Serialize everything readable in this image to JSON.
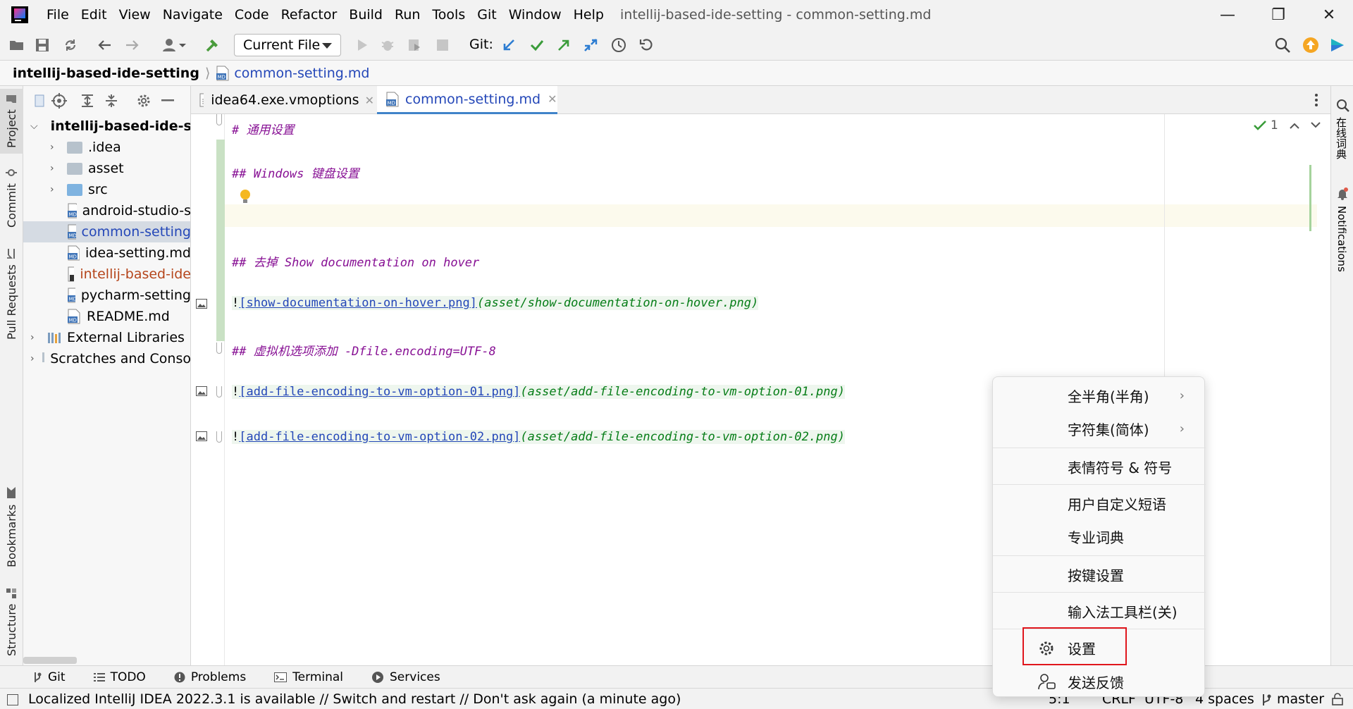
{
  "menubar": {
    "items": [
      "File",
      "Edit",
      "View",
      "Navigate",
      "Code",
      "Refactor",
      "Build",
      "Run",
      "Tools",
      "Git",
      "Window",
      "Help"
    ],
    "title": "intellij-based-ide-setting - common-setting.md"
  },
  "toolbar": {
    "run_config": "Current File",
    "git_label": "Git:"
  },
  "breadcrumb": {
    "project": "intellij-based-ide-setting",
    "file": "common-setting.md"
  },
  "left_strip": {
    "project": "Project",
    "commit": "Commit",
    "pull_requests": "Pull Requests",
    "bookmarks": "Bookmarks",
    "structure": "Structure"
  },
  "project_tree": {
    "root": "intellij-based-ide-se",
    "items": [
      {
        "label": ".idea",
        "type": "folder"
      },
      {
        "label": "asset",
        "type": "folder"
      },
      {
        "label": "src",
        "type": "folder"
      },
      {
        "label": "android-studio-s",
        "type": "md"
      },
      {
        "label": "common-setting",
        "type": "md"
      },
      {
        "label": "idea-setting.md",
        "type": "md"
      },
      {
        "label": "intellij-based-ide",
        "type": "md"
      },
      {
        "label": "pycharm-setting",
        "type": "md"
      },
      {
        "label": "README.md",
        "type": "md"
      }
    ],
    "external_libraries": "External Libraries",
    "scratches": "Scratches and Conso"
  },
  "editor": {
    "tabs": [
      "idea64.exe.vmoptions",
      "common-setting.md"
    ],
    "inspection_count": "1",
    "lines": {
      "l1": "# 通用设置",
      "l2": "## Windows 键盘设置",
      "l3": "## 去掉 Show documentation on hover",
      "l4_bang": "!",
      "l4_link": "[show-documentation-on-hover.png]",
      "l4_path": "(asset/show-documentation-on-hover.png)",
      "l5": "## 虚拟机选项添加 -Dfile.encoding=UTF-8",
      "l6_bang": "!",
      "l6_link": "[add-file-encoding-to-vm-option-01.png]",
      "l6_path": "(asset/add-file-encoding-to-vm-option-01.png)",
      "l7_bang": "!",
      "l7_link": "[add-file-encoding-to-vm-option-02.png]",
      "l7_path": "(asset/add-file-encoding-to-vm-option-02.png)"
    }
  },
  "right_strip": {
    "dictionary": "在线词典",
    "notifications": "Notifications"
  },
  "context_menu": {
    "items": [
      "全半角(半角)",
      "字符集(简体)",
      "表情符号 & 符号",
      "用户自定义短语",
      "专业词典",
      "按键设置",
      "输入法工具栏(关)",
      "设置",
      "发送反馈"
    ]
  },
  "bottom_tabs": [
    "Git",
    "TODO",
    "Problems",
    "Terminal",
    "Services"
  ],
  "status": {
    "message": "Localized IntelliJ IDEA 2022.3.1 is available // Switch and restart // Don't ask again (a minute ago)",
    "position": "5:1",
    "line_sep": "CRLF",
    "encoding": "UTF-8",
    "indent": "4 spaces",
    "branch": "master"
  },
  "colors": {
    "accent": "#2447b8",
    "heading": "#871094",
    "path": "#067d17",
    "highlight_box": "#e0161d"
  }
}
